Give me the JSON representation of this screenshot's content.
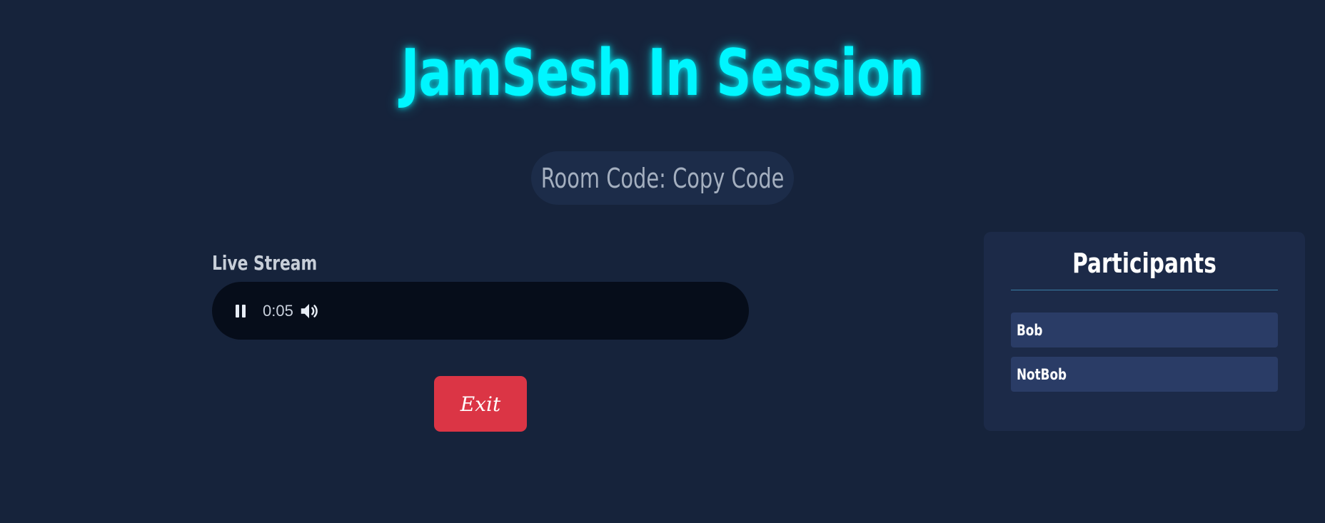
{
  "page": {
    "title": "JamSesh In Session"
  },
  "room": {
    "label": "Room Code:",
    "value": "Copy Code"
  },
  "stream": {
    "label": "Live Stream",
    "player": {
      "state": "playing",
      "time": "0:05",
      "controls": {
        "pause_icon": "pause-icon",
        "volume_icon": "volume-icon"
      }
    }
  },
  "actions": {
    "exit_label": "Exit"
  },
  "participants": {
    "title": "Participants",
    "items": [
      {
        "name": "Bob"
      },
      {
        "name": "NotBob"
      }
    ]
  },
  "colors": {
    "background": "#16233b",
    "title_glow": "#00f6ff",
    "exit_button": "#db3545",
    "panel": "#1c2a48",
    "participant_row": "#2a3c66"
  }
}
